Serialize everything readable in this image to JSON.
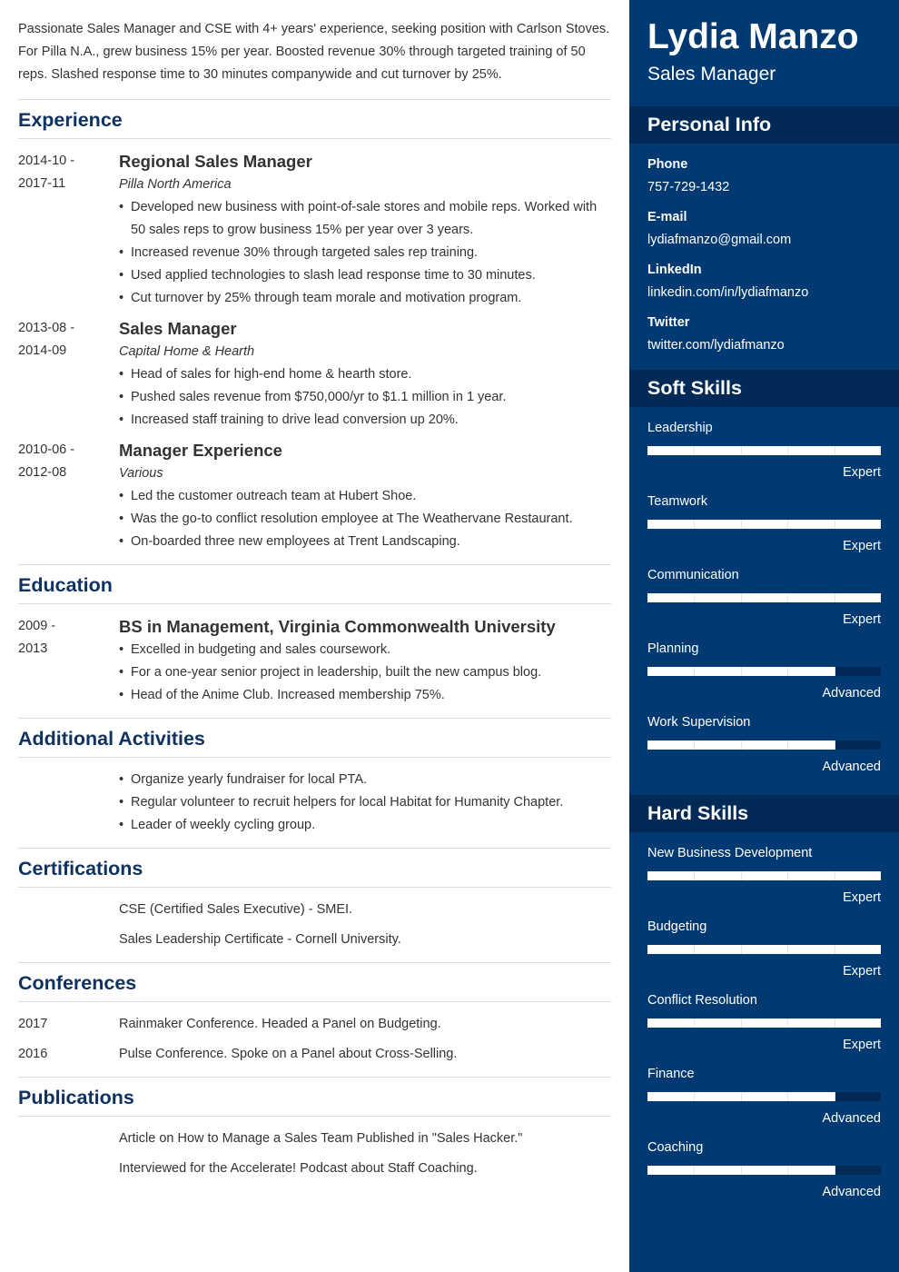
{
  "summary": "Passionate Sales Manager and CSE with 4+ years' experience, seeking position with Carlson Stoves. For Pilla N.A., grew business 15% per year. Boosted revenue 30% through targeted training of 50 reps. Slashed response time to 30 minutes companywide and cut turnover by 25%.",
  "experience": {
    "title": "Experience",
    "entries": [
      {
        "date_start": "2014-10 -",
        "date_end": "2017-11",
        "title": "Regional Sales Manager",
        "company": "Pilla North America",
        "bullets": [
          "Developed new business with point-of-sale stores and mobile reps. Worked with 50 sales reps to grow business 15% per year over 3 years.",
          "Increased revenue 30% through targeted sales rep training.",
          "Used applied technologies to slash lead response time to 30 minutes.",
          "Cut turnover by 25% through team morale and motivation program."
        ]
      },
      {
        "date_start": "2013-08 -",
        "date_end": "2014-09",
        "title": "Sales Manager",
        "company": "Capital Home & Hearth",
        "bullets": [
          "Head of sales for high-end home & hearth store.",
          "Pushed sales revenue from $750,000/yr to $1.1 million in 1 year.",
          "Increased staff training to drive lead conversion up 20%."
        ]
      },
      {
        "date_start": "2010-06 -",
        "date_end": "2012-08",
        "title": "Manager Experience",
        "company": "Various",
        "bullets": [
          "Led the customer outreach team at Hubert Shoe.",
          "Was the go-to conflict resolution employee at The Weathervane Restaurant.",
          "On-boarded three new employees at Trent Landscaping."
        ]
      }
    ]
  },
  "education": {
    "title": "Education",
    "entries": [
      {
        "date_start": "2009 -",
        "date_end": "2013",
        "title": "BS in Management, Virginia Commonwealth University",
        "bullets": [
          "Excelled in budgeting and sales coursework.",
          "For a one-year senior project in leadership, built the new campus blog.",
          "Head of the Anime Club. Increased membership 75%."
        ]
      }
    ]
  },
  "activities": {
    "title": "Additional Activities",
    "bullets": [
      "Organize yearly fundraiser for local PTA.",
      "Regular volunteer to recruit helpers for local Habitat for Humanity Chapter.",
      "Leader of weekly cycling group."
    ]
  },
  "certifications": {
    "title": "Certifications",
    "items": [
      "CSE (Certified Sales Executive) - SMEI.",
      "Sales Leadership Certificate - Cornell University."
    ]
  },
  "conferences": {
    "title": "Conferences",
    "items": [
      {
        "year": "2017",
        "text": "Rainmaker Conference. Headed a Panel on Budgeting."
      },
      {
        "year": "2016",
        "text": "Pulse Conference. Spoke on a Panel about Cross-Selling."
      }
    ]
  },
  "publications": {
    "title": "Publications",
    "items": [
      "Article on How to Manage a Sales Team Published in \"Sales Hacker.\"",
      "Interviewed for the Accelerate! Podcast about Staff Coaching."
    ]
  },
  "sidebar": {
    "name": "Lydia Manzo",
    "role": "Sales Manager",
    "personal_info": {
      "title": "Personal Info",
      "fields": [
        {
          "label": "Phone",
          "value": "757-729-1432"
        },
        {
          "label": "E-mail",
          "value": "lydiafmanzo@gmail.com"
        },
        {
          "label": "LinkedIn",
          "value": "linkedin.com/in/lydiafmanzo"
        },
        {
          "label": "Twitter",
          "value": "twitter.com/lydiafmanzo"
        }
      ]
    },
    "soft_skills": {
      "title": "Soft Skills",
      "items": [
        {
          "name": "Leadership",
          "level": "Expert",
          "fraction": 1.0
        },
        {
          "name": "Teamwork",
          "level": "Expert",
          "fraction": 1.0
        },
        {
          "name": "Communication",
          "level": "Expert",
          "fraction": 1.0
        },
        {
          "name": "Planning",
          "level": "Advanced",
          "fraction": 0.8
        },
        {
          "name": "Work Supervision",
          "level": "Advanced",
          "fraction": 0.8
        }
      ]
    },
    "hard_skills": {
      "title": "Hard Skills",
      "items": [
        {
          "name": "New Business Development",
          "level": "Expert",
          "fraction": 1.0
        },
        {
          "name": "Budgeting",
          "level": "Expert",
          "fraction": 1.0
        },
        {
          "name": "Conflict Resolution",
          "level": "Expert",
          "fraction": 1.0
        },
        {
          "name": "Finance",
          "level": "Advanced",
          "fraction": 0.8
        },
        {
          "name": "Coaching",
          "level": "Advanced",
          "fraction": 0.8
        }
      ]
    }
  },
  "colors": {
    "heading": "#0f3261",
    "sidebar_bg": "#013a73",
    "sidebar_header_bg": "#012a56"
  }
}
